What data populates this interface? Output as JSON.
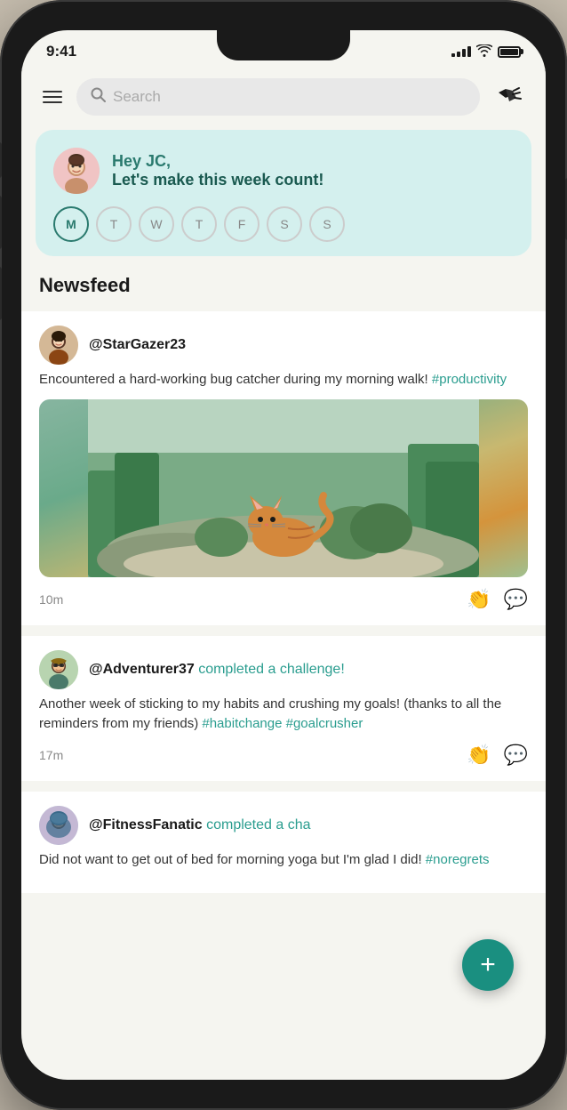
{
  "status": {
    "time": "9:41",
    "signal": [
      3,
      5,
      7,
      9,
      11
    ],
    "battery_full": true
  },
  "header": {
    "search_placeholder": "Search",
    "menu_label": "Menu",
    "notification_label": "Notifications"
  },
  "greeting": {
    "line1": "Hey JC,",
    "line2": "Let's make this week count!",
    "avatar_emoji": "👩",
    "days": [
      {
        "label": "M",
        "active": true
      },
      {
        "label": "T",
        "active": false
      },
      {
        "label": "W",
        "active": false
      },
      {
        "label": "T",
        "active": false
      },
      {
        "label": "F",
        "active": false
      },
      {
        "label": "S",
        "active": false
      },
      {
        "label": "S",
        "active": false
      }
    ]
  },
  "newsfeed": {
    "section_title": "Newsfeed",
    "posts": [
      {
        "username": "@StarGazer23",
        "action": "",
        "avatar_emoji": "👩",
        "body_plain": "Encountered a hard-working bug catcher during my morning walk! ",
        "body_hashtag": "#productivity",
        "has_image": true,
        "time": "10m"
      },
      {
        "username": "@Adventurer37",
        "action": " completed a challenge!",
        "avatar_emoji": "🧔",
        "body_plain": "Another week of sticking to my habits and crushing my goals! (thanks to all the reminders from my friends) ",
        "body_hashtag": "#habitchange #goalcrusher",
        "has_image": false,
        "time": "17m"
      },
      {
        "username": "@FitnessFanatic",
        "action": " completed a cha",
        "avatar_emoji": "🧕",
        "body_plain": "Did not want to get out of bed for morning yoga but I'm glad I did! ",
        "body_hashtag": "#noregrets",
        "has_image": false,
        "time": ""
      }
    ]
  },
  "fab": {
    "label": "+"
  }
}
